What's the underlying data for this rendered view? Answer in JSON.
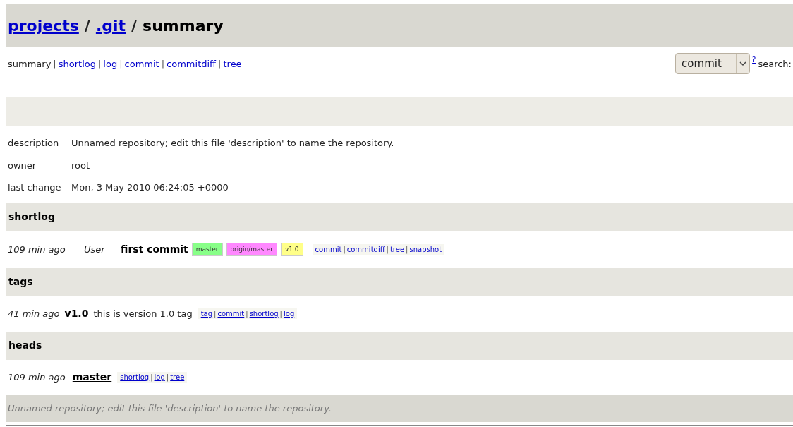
{
  "header": {
    "separator": "/",
    "breadcrumbs": [
      {
        "text": "projects",
        "kind": "link"
      },
      {
        "text": ".git",
        "kind": "link"
      },
      {
        "text": "summary",
        "kind": "current"
      }
    ]
  },
  "nav": {
    "separator": "|",
    "items": [
      {
        "label": "summary",
        "selected": true
      },
      {
        "label": "shortlog",
        "selected": false
      },
      {
        "label": "log",
        "selected": false
      },
      {
        "label": "commit",
        "selected": false
      },
      {
        "label": "commitdiff",
        "selected": false
      },
      {
        "label": "tree",
        "selected": false
      }
    ],
    "search_type": "commit",
    "help": "?",
    "search_label": "search:"
  },
  "projects_list": [
    {
      "label": "description",
      "value": "Unnamed repository; edit this file 'description' to name the repository."
    },
    {
      "label": "owner",
      "value": "root"
    },
    {
      "label": "last change",
      "value": "Mon, 3 May 2010 06:24:05 +0000"
    }
  ],
  "link_separator": "|",
  "shortlog": {
    "title": "shortlog",
    "rows": [
      {
        "age": "109 min ago",
        "author": "User",
        "subject": "first commit",
        "refs": [
          {
            "text": "master",
            "color": "#88ff88"
          },
          {
            "text": "origin/master",
            "color": "#ff88ff"
          },
          {
            "text": "v1.0",
            "color": "#ffff88"
          }
        ],
        "links": [
          "commit",
          "commitdiff",
          "tree",
          "snapshot"
        ]
      }
    ]
  },
  "tags": {
    "title": "tags",
    "rows": [
      {
        "age": "41 min ago",
        "name": "v1.0",
        "comment": "this is version 1.0 tag",
        "links": [
          "tag",
          "commit",
          "shortlog",
          "log"
        ]
      }
    ]
  },
  "heads": {
    "title": "heads",
    "rows": [
      {
        "age": "109 min ago",
        "name": "master",
        "links": [
          "shortlog",
          "log",
          "tree"
        ]
      }
    ]
  },
  "footer": "Unnamed repository; edit this file 'description' to name the repository."
}
